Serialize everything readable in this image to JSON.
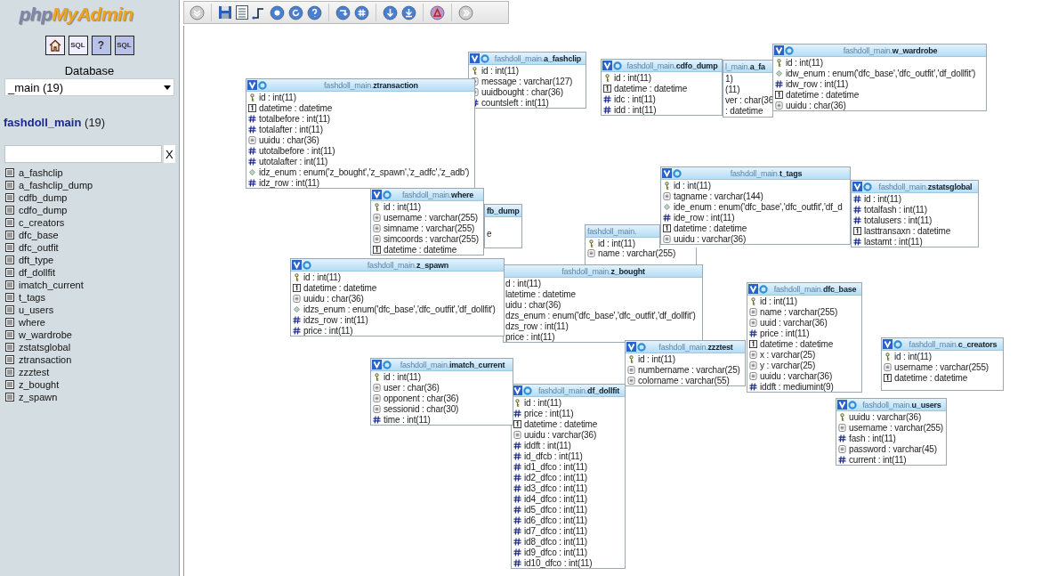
{
  "sidebar": {
    "logo": [
      "php",
      "MyAdmin"
    ],
    "nav_icons": [
      {
        "kind": "home"
      },
      {
        "kind": "sql_window",
        "label": "SQL"
      },
      {
        "kind": "help",
        "label": "?"
      },
      {
        "kind": "sql_query",
        "label": "SQL"
      }
    ],
    "database_label": "Database",
    "database_select": "_main (19)",
    "db_title": {
      "name": "fashdoll_main",
      "count": "(19)"
    },
    "filter": {
      "clear": "X"
    },
    "tables": [
      "a_fashclip",
      "a_fashclip_dump",
      "cdfb_dump",
      "cdfo_dump",
      "c_creators",
      "dfc_base",
      "dfc_outfit",
      "dft_type",
      "df_dollfit",
      "imatch_current",
      "t_tags",
      "u_users",
      "where",
      "w_wardrobe",
      "zstatsglobal",
      "ztransaction",
      "zzztest",
      "z_bought",
      "z_spawn"
    ]
  },
  "designer": {
    "tables": [
      {
        "schema": "fashdoll_main.",
        "name": "a_fashclip",
        "columns": [
          {
            "kind": "key",
            "text": "id : int(11)"
          },
          {
            "kind": "text",
            "text": "message : varchar(127)"
          },
          {
            "kind": "text",
            "text": "uuidbought : char(36)"
          },
          {
            "kind": "number",
            "text": "countsleft : int(11)"
          }
        ]
      },
      {
        "schema": "fashdoll_main.",
        "name": "cdfo_dump",
        "columns": [
          {
            "kind": "key",
            "text": "id : int(11)"
          },
          {
            "kind": "date",
            "text": "datetime : datetime"
          },
          {
            "kind": "number",
            "text": "idc : int(11)"
          },
          {
            "kind": "number",
            "text": "idd : int(11)"
          }
        ]
      },
      {
        "schema": "l_main.",
        "name": "a_fa",
        "columns": [
          {
            "kind": "cut",
            "text": "1)"
          },
          {
            "kind": "cut",
            "text": "(11)"
          },
          {
            "kind": "cut",
            "text": "ver : char(36"
          },
          {
            "kind": "cut",
            "text": ": datetime"
          }
        ]
      },
      {
        "schema": "fashdoll_main.",
        "name": "w_wardrobe",
        "columns": [
          {
            "kind": "key",
            "text": "id : int(11)"
          },
          {
            "kind": "enum",
            "text": "idw_enum : enum('dfc_base','dfc_outfit','df_dollfit')"
          },
          {
            "kind": "number",
            "text": "idw_row : int(11)"
          },
          {
            "kind": "date",
            "text": "datetime : datetime"
          },
          {
            "kind": "text",
            "text": "uuidu : char(36)"
          }
        ]
      },
      {
        "schema": "fashdoll_main.",
        "name": "ztransaction",
        "columns": [
          {
            "kind": "key",
            "text": "id : int(11)"
          },
          {
            "kind": "date",
            "text": "datetime : datetime"
          },
          {
            "kind": "number",
            "text": "totalbefore : int(11)"
          },
          {
            "kind": "number",
            "text": "totalafter : int(11)"
          },
          {
            "kind": "text",
            "text": "uuidu : char(36)"
          },
          {
            "kind": "number",
            "text": "utotalbefore : int(11)"
          },
          {
            "kind": "number",
            "text": "utotalafter : int(11)"
          },
          {
            "kind": "enum",
            "text": "idz_enum : enum('z_bought','z_spawn','z_adfc','z_adb')"
          },
          {
            "kind": "number",
            "text": "idz_row : int(11)"
          }
        ]
      },
      {
        "schema": "fashdoll_main.",
        "name": "where",
        "columns": [
          {
            "kind": "key",
            "text": "id : int(11)"
          },
          {
            "kind": "text",
            "text": "username : varchar(255)"
          },
          {
            "kind": "text",
            "text": "simname : varchar(255)"
          },
          {
            "kind": "text",
            "text": "simcoords : varchar(255)"
          },
          {
            "kind": "date",
            "text": "datetime : datetime"
          }
        ]
      },
      {
        "name": "fb_dump",
        "columns": [
          {
            "kind": "cut",
            "text": "e"
          }
        ]
      },
      {
        "schema": "fashdoll_main.",
        "columns": [
          {
            "kind": "key",
            "text": "id : int(11)"
          },
          {
            "kind": "text",
            "text": "name : varchar(255)"
          }
        ]
      },
      {
        "schema": "fashdoll_main.",
        "name": "t_tags",
        "columns": [
          {
            "kind": "key",
            "text": "id : int(11)"
          },
          {
            "kind": "text",
            "text": "tagname : varchar(144)"
          },
          {
            "kind": "enum",
            "text": "ide_enum : enum('dfc_base','dfc_outfit','df_d"
          },
          {
            "kind": "number",
            "text": "ide_row : int(11)"
          },
          {
            "kind": "date",
            "text": "datetime : datetime"
          },
          {
            "kind": "text",
            "text": "uuidu : varchar(36)"
          }
        ]
      },
      {
        "schema": "fashdoll_main.",
        "name": "zstatsglobal",
        "columns": [
          {
            "kind": "number",
            "text": "id : int(11)"
          },
          {
            "kind": "number",
            "text": "totalfash : int(11)"
          },
          {
            "kind": "number",
            "text": "totalusers : int(11)"
          },
          {
            "kind": "date",
            "text": "lasttransaxn : datetime"
          },
          {
            "kind": "number",
            "text": "lastamt : int(11)"
          }
        ]
      },
      {
        "schema": "fashdoll_main.",
        "name": "z_spawn",
        "columns": [
          {
            "kind": "key",
            "text": "id : int(11)"
          },
          {
            "kind": "date",
            "text": "datetime : datetime"
          },
          {
            "kind": "text",
            "text": "uuidu : char(36)"
          },
          {
            "kind": "enum",
            "text": "idzs_enum : enum('dfc_base','dfc_outfit','df_dollfit')"
          },
          {
            "kind": "number",
            "text": "idzs_row : int(11)"
          },
          {
            "kind": "number",
            "text": "price : int(11)"
          }
        ]
      },
      {
        "schema": "fashdoll_main.",
        "name": "z_bought",
        "columns": [
          {
            "kind": "cut",
            "text": "d : int(11)"
          },
          {
            "kind": "cut",
            "text": "latetime : datetime"
          },
          {
            "kind": "cut",
            "text": "uidu : char(36)"
          },
          {
            "kind": "cut",
            "text": "dzs_enum : enum('dfc_base','dfc_outfit','df_dollfit')"
          },
          {
            "kind": "cut",
            "text": "dzs_row : int(11)"
          },
          {
            "kind": "cut",
            "text": "price : int(11)"
          }
        ]
      },
      {
        "schema": "fashdoll_main.",
        "name": "dfc_base",
        "columns": [
          {
            "kind": "key",
            "text": "id : int(11)"
          },
          {
            "kind": "text",
            "text": "name : varchar(255)"
          },
          {
            "kind": "text",
            "text": "uuid : varchar(36)"
          },
          {
            "kind": "number",
            "text": "price : int(11)"
          },
          {
            "kind": "date",
            "text": "datetime : datetime"
          },
          {
            "kind": "text",
            "text": "x : varchar(25)"
          },
          {
            "kind": "text",
            "text": "y : varchar(25)"
          },
          {
            "kind": "text",
            "text": "uuidu : varchar(36)"
          },
          {
            "kind": "number",
            "text": "iddft : mediumint(9)"
          }
        ]
      },
      {
        "schema": "fashdoll_main.",
        "name": "zzztest",
        "columns": [
          {
            "kind": "key",
            "text": "id : int(11)"
          },
          {
            "kind": "text",
            "text": "numbername : varchar(25)"
          },
          {
            "kind": "text",
            "text": "colorname : varchar(55)"
          }
        ]
      },
      {
        "schema": "fashdoll_main.",
        "name": "c_creators",
        "columns": [
          {
            "kind": "key",
            "text": "id : int(11)"
          },
          {
            "kind": "text",
            "text": "username : varchar(255)"
          },
          {
            "kind": "date",
            "text": "datetime : datetime"
          }
        ]
      },
      {
        "schema": "fashdoll_main.",
        "name": "imatch_current",
        "columns": [
          {
            "kind": "key",
            "text": "id : int(11)"
          },
          {
            "kind": "text",
            "text": "user : char(36)"
          },
          {
            "kind": "text",
            "text": "opponent : char(36)"
          },
          {
            "kind": "text",
            "text": "sessionid : char(30)"
          },
          {
            "kind": "number",
            "text": "time : int(11)"
          }
        ]
      },
      {
        "schema": "fashdoll_main.",
        "name": "df_dollfit",
        "columns": [
          {
            "kind": "key",
            "text": "id : int(11)"
          },
          {
            "kind": "number",
            "text": "price : int(11)"
          },
          {
            "kind": "date",
            "text": "datetime : datetime"
          },
          {
            "kind": "text",
            "text": "uuidu : varchar(36)"
          },
          {
            "kind": "number",
            "text": "iddft : int(11)"
          },
          {
            "kind": "number",
            "text": "id_dfcb : int(11)"
          },
          {
            "kind": "number",
            "text": "id1_dfco : int(11)"
          },
          {
            "kind": "number",
            "text": "id2_dfco : int(11)"
          },
          {
            "kind": "number",
            "text": "id3_dfco : int(11)"
          },
          {
            "kind": "number",
            "text": "id4_dfco : int(11)"
          },
          {
            "kind": "number",
            "text": "id5_dfco : int(11)"
          },
          {
            "kind": "number",
            "text": "id6_dfco : int(11)"
          },
          {
            "kind": "number",
            "text": "id7_dfco : int(11)"
          },
          {
            "kind": "number",
            "text": "id8_dfco : int(11)"
          },
          {
            "kind": "number",
            "text": "id9_dfco : int(11)"
          },
          {
            "kind": "number",
            "text": "id10_dfco : int(11)"
          }
        ]
      },
      {
        "schema": "fashdoll_main.",
        "name": "u_users",
        "columns": [
          {
            "kind": "key",
            "text": "uuidu : varchar(36)"
          },
          {
            "kind": "text",
            "text": "username : varchar(255)"
          },
          {
            "kind": "number",
            "text": "fash : int(11)"
          },
          {
            "kind": "text",
            "text": "password : varchar(45)"
          },
          {
            "kind": "number",
            "text": "current : int(11)"
          }
        ]
      }
    ]
  }
}
